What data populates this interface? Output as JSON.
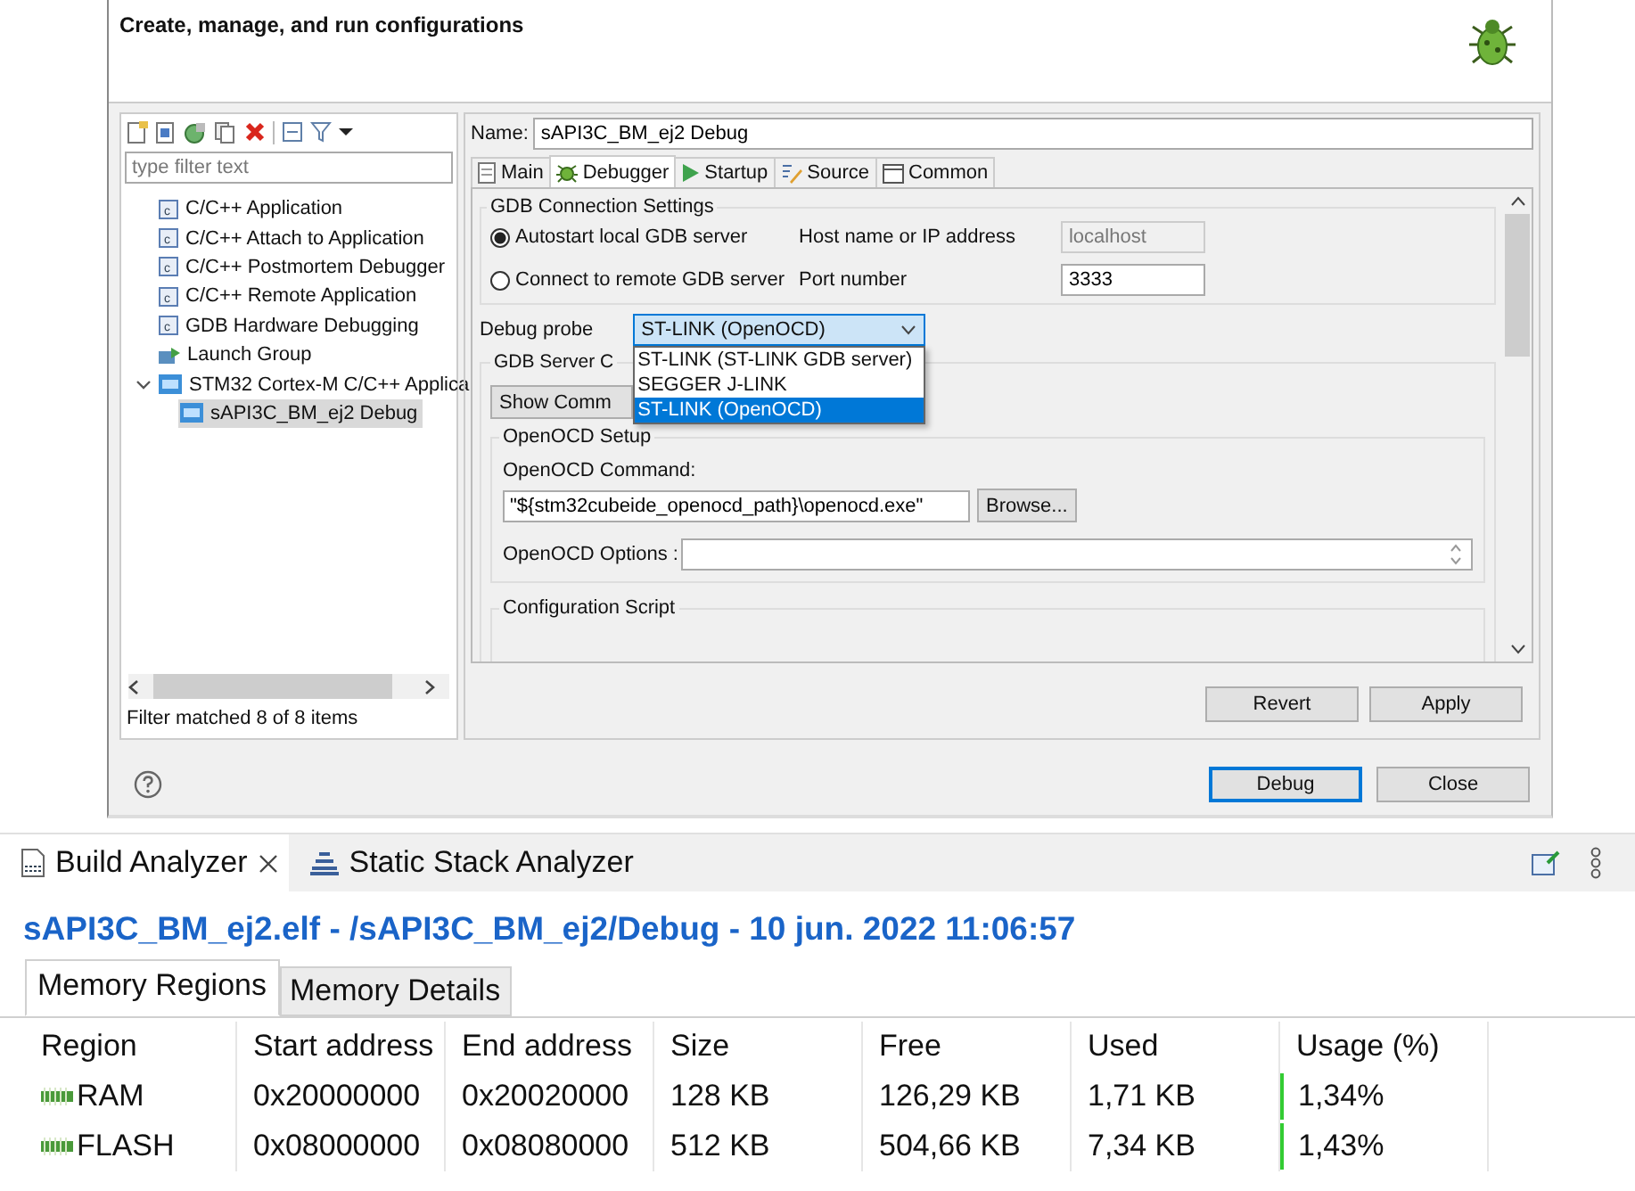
{
  "dialog": {
    "heading": "Create, manage, and run configurations",
    "filter": {
      "placeholder": "type filter text"
    },
    "tree": [
      {
        "label": "C/C++ Application",
        "kind": "c",
        "selected": false
      },
      {
        "label": "C/C++ Attach to Application",
        "kind": "c",
        "selected": false
      },
      {
        "label": "C/C++ Postmortem Debugger",
        "kind": "c",
        "selected": false
      },
      {
        "label": "C/C++ Remote Application",
        "kind": "c",
        "selected": false
      },
      {
        "label": "GDB Hardware Debugging",
        "kind": "c",
        "selected": false
      },
      {
        "label": "Launch Group",
        "kind": "group",
        "selected": false
      },
      {
        "label": "STM32 Cortex-M C/C++ Applica",
        "kind": "ide",
        "selected": false,
        "expanded": true,
        "children": [
          {
            "label": "sAPI3C_BM_ej2 Debug",
            "kind": "ide",
            "selected": true
          }
        ]
      }
    ],
    "filter_status": "Filter matched 8 of 8 items",
    "name_label": "Name:",
    "name_value": "sAPI3C_BM_ej2 Debug",
    "tabs": [
      {
        "label": "Main",
        "kind": "main",
        "selected": false
      },
      {
        "label": "Debugger",
        "kind": "debugger",
        "selected": true
      },
      {
        "label": "Startup",
        "kind": "startup",
        "selected": false
      },
      {
        "label": "Source",
        "kind": "source",
        "selected": false
      },
      {
        "label": "Common",
        "kind": "common",
        "selected": false
      }
    ],
    "gdb_connection": {
      "title": "GDB Connection Settings",
      "options": [
        {
          "label": "Autostart local GDB server",
          "selected": true
        },
        {
          "label": "Connect to remote GDB server",
          "selected": false
        }
      ],
      "host_label": "Host name or IP address",
      "host_value": "localhost",
      "host_disabled": true,
      "port_label": "Port number",
      "port_value": "3333"
    },
    "debug_probe": {
      "label": "Debug probe",
      "value": "ST-LINK (OpenOCD)",
      "expanded": true,
      "options": [
        {
          "label": "ST-LINK (ST-LINK GDB server)",
          "selected": false
        },
        {
          "label": "SEGGER J-LINK",
          "selected": false
        },
        {
          "label": "ST-LINK (OpenOCD)",
          "selected": true
        }
      ]
    },
    "gdb_server_title": "GDB Server C",
    "show_command_button": "Show Comm",
    "openocd_setup": {
      "title": "OpenOCD Setup",
      "command_label": "OpenOCD Command:",
      "command_value": "\"${stm32cubeide_openocd_path}\\openocd.exe\"",
      "browse_button": "Browse...",
      "options_label": "OpenOCD Options :"
    },
    "config_script_title": "Configuration Script",
    "buttons": [
      {
        "label": "Revert"
      },
      {
        "label": "Apply"
      }
    ],
    "footer_buttons": [
      {
        "label": "Debug",
        "default": true
      },
      {
        "label": "Close",
        "default": false
      }
    ]
  },
  "analyzer": {
    "tabs": [
      {
        "label": "Build Analyzer",
        "kind": "build",
        "selected": true,
        "closable": true
      },
      {
        "label": "Static Stack Analyzer",
        "kind": "stack",
        "selected": false,
        "closable": false
      }
    ],
    "title": "sAPI3C_BM_ej2.elf - /sAPI3C_BM_ej2/Debug - 10 jun. 2022 11:06:57",
    "subtabs": [
      {
        "label": "Memory Regions",
        "selected": true
      },
      {
        "label": "Memory Details",
        "selected": false
      }
    ],
    "table": {
      "columns": [
        "Region",
        "Start address",
        "End address",
        "Size",
        "Free",
        "Used",
        "Usage (%)"
      ],
      "rows": [
        {
          "region": "RAM",
          "start": "0x20000000",
          "end": "0x20020000",
          "size": "128 KB",
          "free": "126,29 KB",
          "used": "1,71 KB",
          "usage": "1,34%",
          "level": 0.0134
        },
        {
          "region": "FLASH",
          "start": "0x08000000",
          "end": "0x08080000",
          "size": "512 KB",
          "free": "504,66 KB",
          "used": "7,34 KB",
          "usage": "1,43%",
          "level": 0.0143
        }
      ]
    }
  }
}
